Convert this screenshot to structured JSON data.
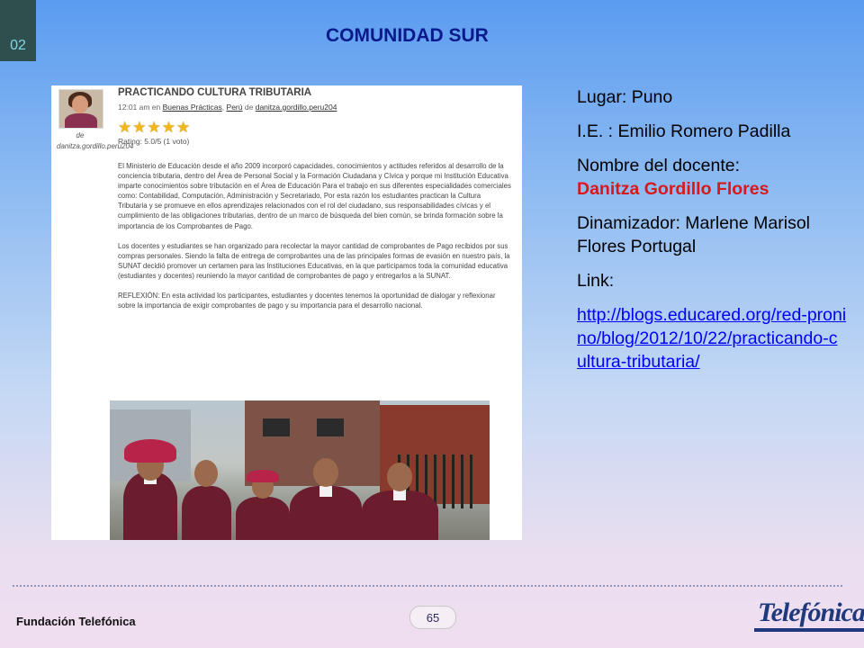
{
  "slide_number": "02",
  "title": "COMUNIDAD SUR",
  "blog": {
    "author": "de danitza.gordillo.peru204",
    "post_title": "PRACTICANDO CULTURA TRIBUTARIA",
    "meta_prefix": "12:01 am en",
    "meta_links": [
      "Buenas Prácticas",
      "Perú"
    ],
    "meta_de": "de",
    "meta_author": "danitza.gordillo.peru204",
    "rating": "Rating: 5.0/5 (1 voto)",
    "stars": 5,
    "paragraphs": [
      "El Ministerio de Educación desde el año 2009 incorporó capacidades, conocimientos y actitudes referidos al desarrollo de la conciencia tributaria, dentro del Área de Personal Social y la Formación Ciudadana y Cívica y porque mi Institución Educativa imparte conocimientos sobre tributación en el Área de Educación Para el trabajo en sus diferentes especialidades comerciales como: Contabilidad, Computación, Administración y Secretariado, Por esta razón los estudiantes practican la Cultura Tributaria y se promueve en ellos aprendizajes relacionados con el rol del ciudadano, sus responsabilidades cívicas y el cumplimiento de las obligaciones tributarias, dentro de un marco de búsqueda del bien común, se brinda formación sobre la importancia de los Comprobantes de Pago.",
      "Los docentes y estudiantes se han organizado para recolectar la mayor cantidad de comprobantes de Pago recibidos por sus compras personales. Siendo la falta de entrega de comprobantes una de las principales formas de evasión en nuestro país, la SUNAT decidió promover un certamen para las Instituciones Educativas, en la que participamos toda la comunidad educativa (estudiantes y docentes) reuniendo la mayor cantidad de comprobantes de pago y entregarlos a la SUNAT.",
      "REFLEXIÓN: En esta actividad los participantes, estudiantes y docentes tenemos la oportunidad de dialogar y reflexionar sobre la importancia de exigir comprobantes de pago y su importancia para el desarrollo nacional."
    ]
  },
  "info": {
    "lugar": "Lugar: Puno",
    "ie": "I.E. : Emilio Romero Padilla",
    "docente_label": "Nombre del docente:",
    "docente_name": "Danitza Gordillo Flores",
    "dinamizador": "Dinamizador: Marlene Marisol Flores Portugal",
    "link_label": "Link:",
    "link_url": "http://blogs.educared.org/red-pronino/blog/2012/10/22/practicando-cultura-tributaria/"
  },
  "footer": {
    "org": "Fundación Telefónica",
    "page": "65",
    "logo_text": "Telefónica"
  },
  "colors": {
    "title": "#0a1a8c",
    "highlight": "#d7191c",
    "link": "#0000ff"
  }
}
